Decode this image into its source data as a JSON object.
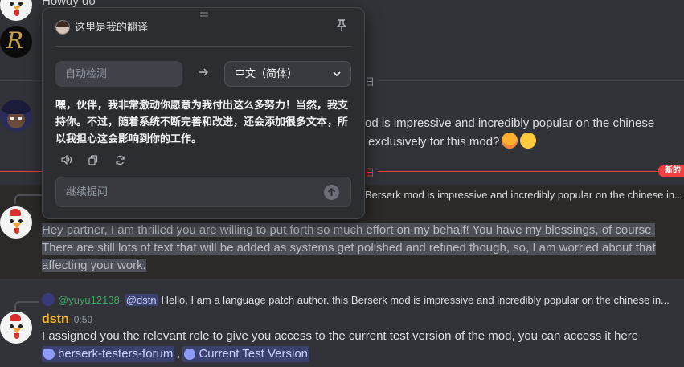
{
  "chat": {
    "top_partial": "Howdy do",
    "date_divider_1": "日",
    "date_divider_2": "日",
    "new_badge": "新的",
    "msg_anime_line1": "od is impressive and incredibly popular on the chinese",
    "msg_anime_line2": "exclusively for this mod?",
    "reply1_text": "Berserk mod is impressive and incredibly popular on the chinese in...",
    "translated_line1": "Hey partner, I am thrilled you are willing to put forth so much effort on my behalf! You have my blessings, of course.",
    "translated_line2": "There are still lots of text that will be added as systems get polished and refined though, so, I am worried about that",
    "translated_line3": "affecting your work.",
    "reply2_name": "@yuyu12138",
    "reply2_mention": "@dstn",
    "reply2_text": "Hello, I am a language patch author. this Berserk mod is impressive and incredibly popular on the chinese in...",
    "author": "dstn",
    "time": "0:59",
    "body": "I assigned you the relevant role to give you access to the current test version of the mod, you can access it here",
    "channel_forum": "berserk-testers-forum",
    "channel_sep": "›",
    "channel_thread": "Current Test Version"
  },
  "popup": {
    "title": "这里是我的翻译",
    "source_lang": "自动检测",
    "target_lang": "中文（简体）",
    "translation": "嘿，伙伴，我非常激动你愿意为我付出这么多努力！当然，我支持你。不过，随着系统不断完善和改进，还会添加很多文本，所以我担心这会影响到你的工作。",
    "followup_placeholder": "继续提问",
    "icons": {
      "pin": "pin-icon",
      "arrow": "arrow-right-icon",
      "speaker": "speaker-icon",
      "copy": "copy-icon",
      "refresh": "refresh-icon",
      "send": "send-arrow-icon"
    }
  },
  "colors": {
    "background": "#313338",
    "popup_bg": "#2b2d31",
    "username": "#f0b232",
    "new_red": "#f23f42",
    "mention_bg": "#3c4270"
  }
}
